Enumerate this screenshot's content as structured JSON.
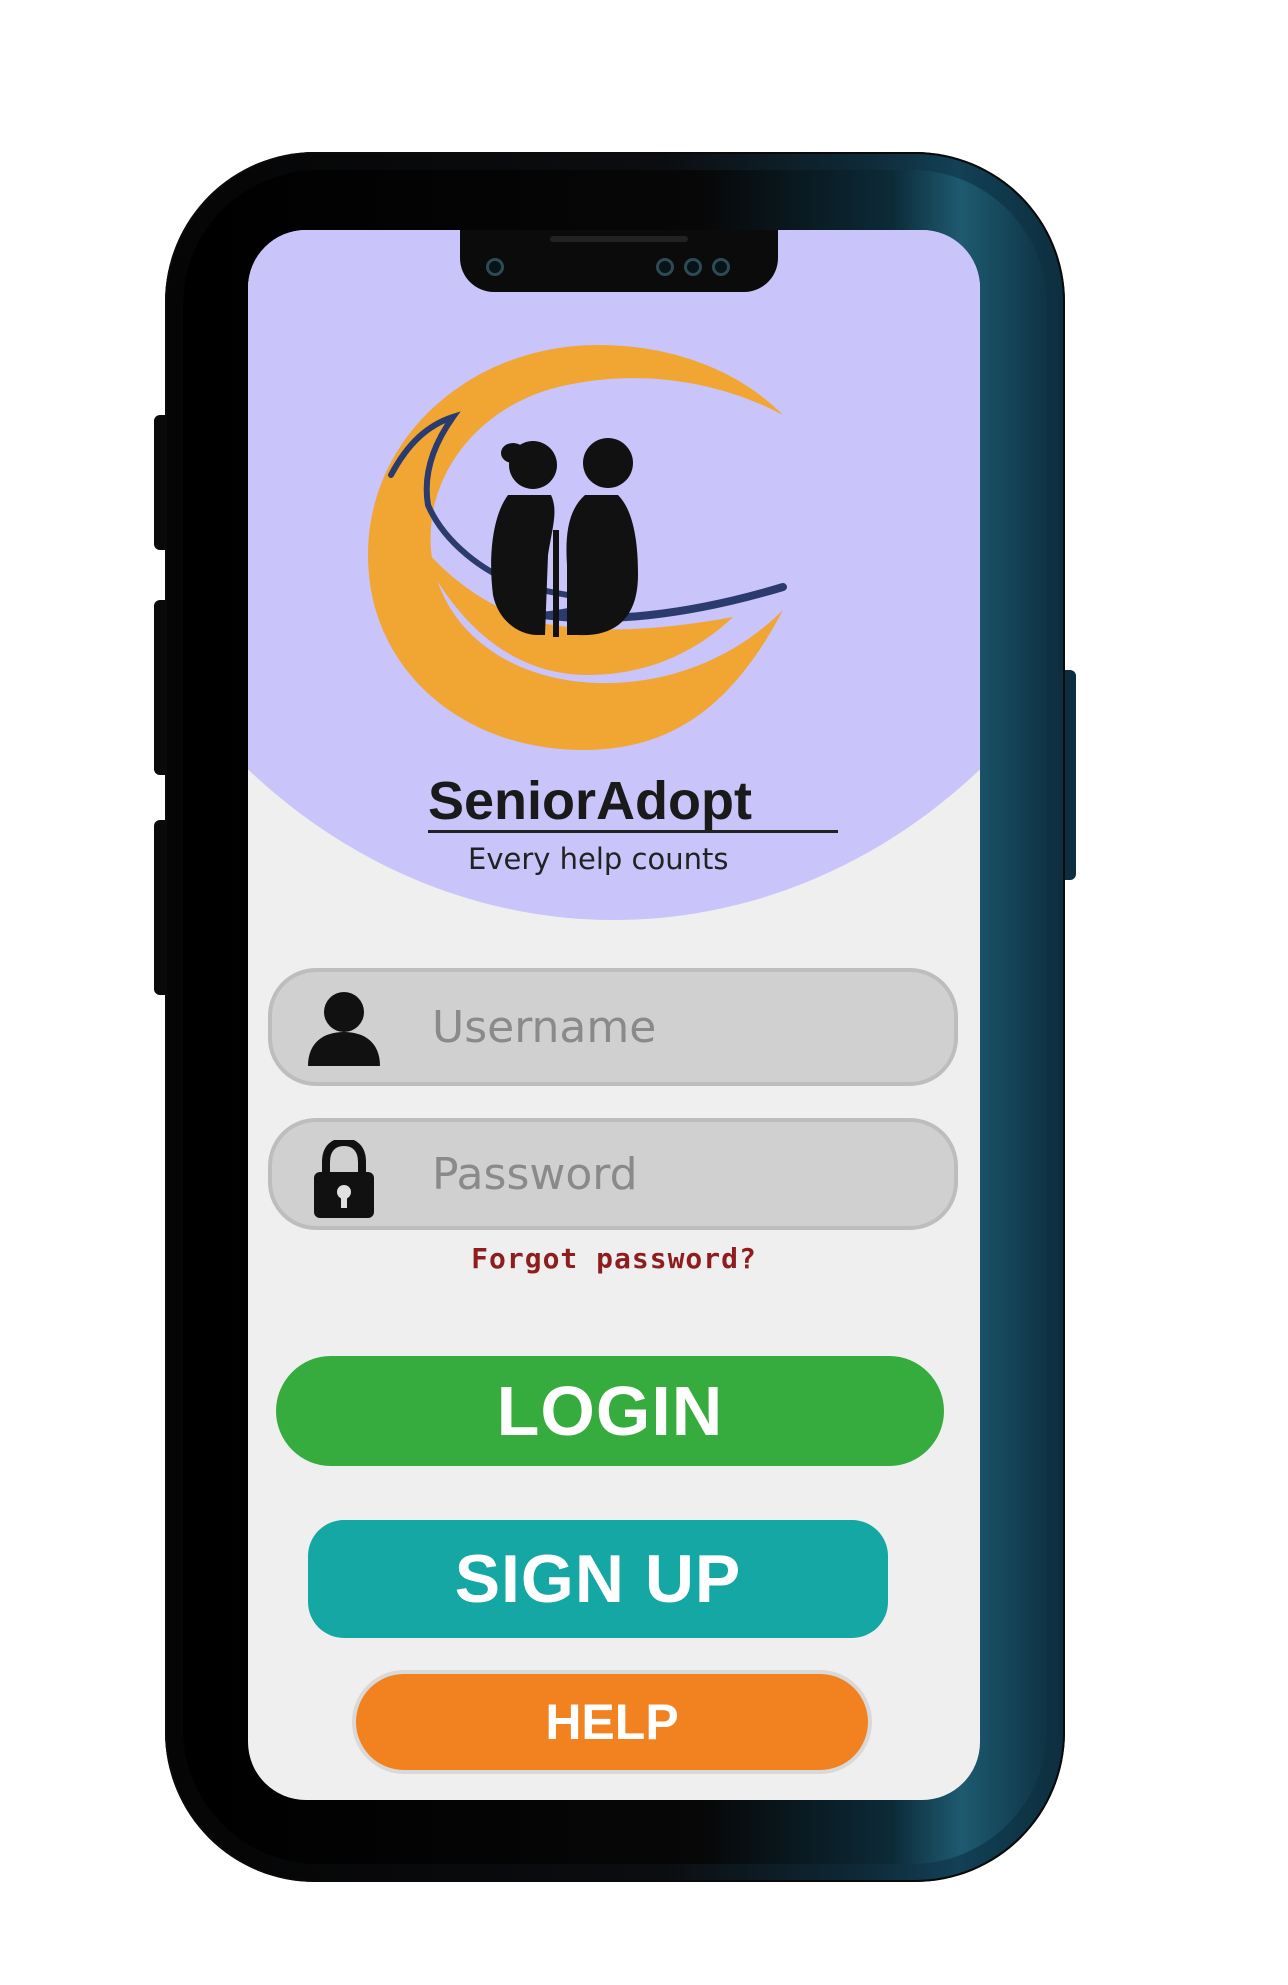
{
  "app": {
    "name": "SeniorAdopt",
    "tagline": "Every help counts"
  },
  "login_form": {
    "username_placeholder": "Username",
    "password_placeholder": "Password",
    "forgot_password_label": "Forgot password?"
  },
  "actions": {
    "login_label": "LOGIN",
    "signup_label": "SIGN UP",
    "help_label": "HELP"
  },
  "icons": {
    "username": "user-icon",
    "password": "lock-icon",
    "logo": "senior-couple-hand-logo"
  },
  "colors": {
    "hero_background": "#c9c4fa",
    "screen_background": "#efefef",
    "logo_orange": "#f1a533",
    "logo_navy": "#2c3b6e",
    "login_button": "#36ac3f",
    "signup_button": "#14a7a4",
    "help_button": "#f2811f",
    "forgot_password_text": "#8e1e1e"
  }
}
